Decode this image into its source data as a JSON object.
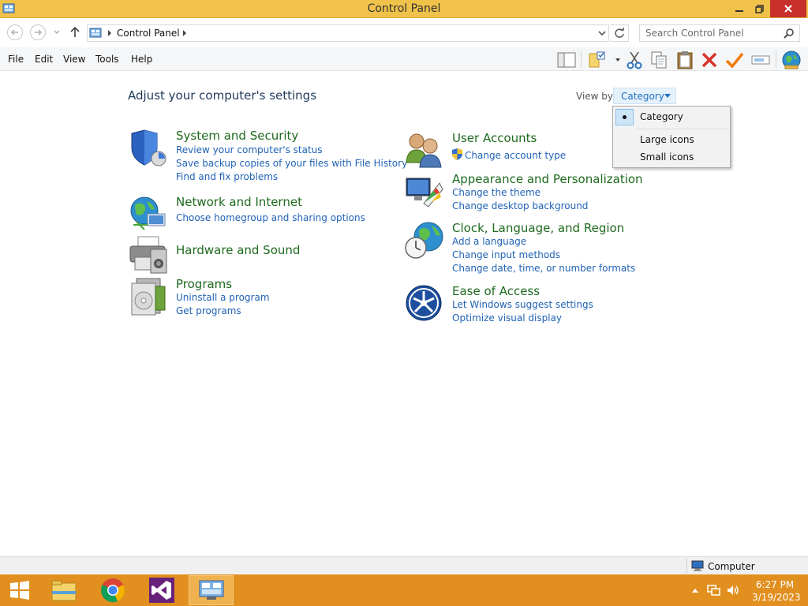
{
  "window": {
    "title": "Control Panel",
    "colors": {
      "titlebar": "#f1c24a",
      "close": "#c7302b",
      "taskbar": "#e1901f"
    }
  },
  "address": {
    "crumb": "Control Panel",
    "search_placeholder": "Search Control Panel"
  },
  "menu": {
    "items": [
      "File",
      "Edit",
      "View",
      "Tools",
      "Help"
    ]
  },
  "toolbar_icons": [
    "layout-pane-icon",
    "folder-options-icon",
    "cut-icon",
    "copy-icon",
    "paste-icon",
    "delete-icon",
    "properties-check-icon",
    "rename-icon",
    "network-globe-icon"
  ],
  "content": {
    "page_title": "Adjust your computer's settings",
    "view_by_label": "View by:",
    "view_by_value": "Category",
    "categories_left": [
      {
        "title": "System and Security",
        "icon": "shield-icon",
        "links": [
          "Review your computer's status",
          "Save backup copies of your files with File History",
          "Find and fix problems"
        ]
      },
      {
        "title": "Network and Internet",
        "icon": "network-icon",
        "links": [
          "Choose homegroup and sharing options"
        ]
      },
      {
        "title": "Hardware and Sound",
        "icon": "printer-icon",
        "links": []
      },
      {
        "title": "Programs",
        "icon": "programs-icon",
        "links": [
          "Uninstall a program",
          "Get programs"
        ]
      }
    ],
    "categories_right": [
      {
        "title": "User Accounts",
        "icon": "users-icon",
        "links": [
          "Change account type"
        ]
      },
      {
        "title": "Appearance and Personalization",
        "icon": "appearance-icon",
        "links": [
          "Change the theme",
          "Change desktop background"
        ]
      },
      {
        "title": "Clock, Language, and Region",
        "icon": "clock-globe-icon",
        "links": [
          "Add a language",
          "Change input methods",
          "Change date, time, or number formats"
        ]
      },
      {
        "title": "Ease of Access",
        "icon": "ease-of-access-icon",
        "links": [
          "Let Windows suggest settings",
          "Optimize visual display"
        ]
      }
    ]
  },
  "dropdown": {
    "options": [
      "Category",
      "Large icons",
      "Small icons"
    ],
    "selected": "Category"
  },
  "statusbar": {
    "location": "Computer"
  },
  "taskbar": {
    "apps": [
      "windows-start-icon",
      "file-explorer-icon",
      "chrome-icon",
      "visual-studio-icon",
      "control-panel-icon"
    ],
    "time": "6:27 PM",
    "date": "3/19/2023"
  }
}
